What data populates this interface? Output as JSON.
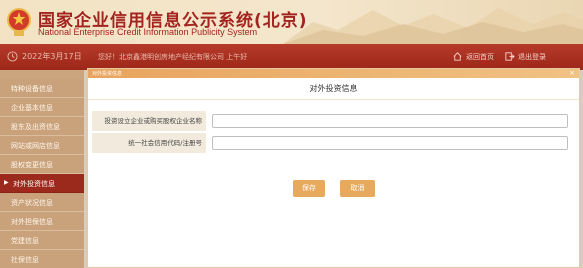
{
  "header": {
    "title": "国家企业信用信息公示系统(北京)",
    "subtitle": "National Enterprise Credit Information Publicity System"
  },
  "toolbar": {
    "date": "2022年3月17日",
    "company": "您好！北京鑫港明创房地产经纪有限公司  上午好",
    "home_label": "返回首页",
    "exit_label": "退出登录"
  },
  "sidebar": {
    "items": [
      {
        "label": "特种设备信息",
        "active": false
      },
      {
        "label": "企业基本信息",
        "active": false
      },
      {
        "label": "股东及出资信息",
        "active": false
      },
      {
        "label": "网站或网店信息",
        "active": false
      },
      {
        "label": "股权变更信息",
        "active": false
      },
      {
        "label": "对外投资信息",
        "active": true
      },
      {
        "label": "资产状况信息",
        "active": false
      },
      {
        "label": "对外担保信息",
        "active": false
      },
      {
        "label": "党建信息",
        "active": false
      },
      {
        "label": "社保信息",
        "active": false
      }
    ]
  },
  "modal": {
    "titlebar": "对外投资信息",
    "heading": "对外投资信息",
    "fields": [
      {
        "label": "投资设立企业或购买股权企业名称",
        "value": "",
        "placeholder": ""
      },
      {
        "label": "统一社会信用代码/注册号",
        "value": "",
        "placeholder": ""
      }
    ],
    "save_label": "保存",
    "cancel_label": "取消"
  },
  "colors": {
    "brand_red": "#a3231f",
    "toolbar_red": "#b73a2a",
    "sidebar_tan": "#c9a27b",
    "sidebar_active": "#9b2a1c",
    "button_orange": "#e7a95c"
  }
}
